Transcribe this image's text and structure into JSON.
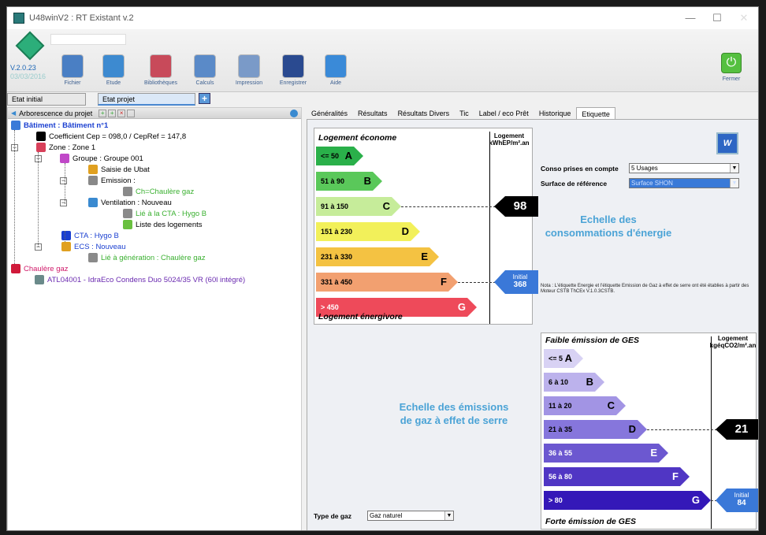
{
  "window": {
    "title": "U48winV2 : RT Existant v.2",
    "controls": [
      "—",
      "☐",
      "✕"
    ]
  },
  "toolbar": {
    "version": "V.2.0.23",
    "version_date": "03/03/2016",
    "buttons": [
      {
        "label": "Fichier",
        "icon": "fichier-icon",
        "color": "#4a7fc4"
      },
      {
        "label": "Etude",
        "icon": "etude-icon",
        "color": "#3d8ad0"
      },
      {
        "label": "Bibliothèques",
        "icon": "books-icon",
        "color": "#c84a5a"
      },
      {
        "label": "Calculs",
        "icon": "calculator-icon",
        "color": "#5a8ac8"
      },
      {
        "label": "Impression",
        "icon": "printer-icon",
        "color": "#7a9ac8"
      },
      {
        "label": "Enregistrer",
        "icon": "save-icon",
        "color": "#2a4a90"
      },
      {
        "label": "Aide",
        "icon": "help-icon",
        "color": "#3a8ad8"
      }
    ],
    "close_label": "Fermer"
  },
  "state_tabs": [
    "Etat initial",
    "Etat projet"
  ],
  "tree": {
    "header": "Arborescence du projet",
    "items": [
      {
        "text": "Bâtiment : Bâtiment n°1",
        "color": "#1a3fd0",
        "bold": true
      },
      {
        "text": "Coefficient Cep =  098,0 / CepRef =  147,8",
        "color": "#000"
      },
      {
        "text": "Zone : Zone 1",
        "color": "#000"
      },
      {
        "text": "Groupe : Groupe 001",
        "color": "#000"
      },
      {
        "text": "Saisie de Ubat",
        "color": "#000"
      },
      {
        "text": "Emission :",
        "color": "#000"
      },
      {
        "text": "Ch=Chaulère gaz",
        "color": "#3ab030"
      },
      {
        "text": "Ventilation : Nouveau",
        "color": "#000"
      },
      {
        "text": "Lié à la CTA : Hygo B",
        "color": "#3ab030"
      },
      {
        "text": "Liste des logements",
        "color": "#000"
      },
      {
        "text": "CTA : Hygo B",
        "color": "#1a3fd0"
      },
      {
        "text": "ECS : Nouveau",
        "color": "#1a3fd0"
      },
      {
        "text": "Lié à génération : Chaulère gaz",
        "color": "#3ab030"
      },
      {
        "text": "Chaulère gaz",
        "color": "#d01a6a"
      },
      {
        "text": "ATL04001 - IdraEco Condens Duo 5024/35 VR (60l intégré)",
        "color": "#6a2ab0"
      }
    ]
  },
  "right_tabs": [
    "Généralités",
    "Résultats",
    "Résultats Divers",
    "Tic",
    "Label / eco Prêt",
    "Historique",
    "Etiquette"
  ],
  "energy": {
    "top": "Logement économe",
    "bottom": "Logement énergivore",
    "unit_title": "Logement",
    "unit": "kWhEP/m².an",
    "classes": [
      {
        "range": "<= 50",
        "letter": "A",
        "color": "#2ab04a"
      },
      {
        "range": "51 à 90",
        "letter": "B",
        "color": "#5ac85a"
      },
      {
        "range": "91 à 150",
        "letter": "C",
        "color": "#c6ec9a"
      },
      {
        "range": "151 à 230",
        "letter": "D",
        "color": "#f2f05a"
      },
      {
        "range": "231 à 330",
        "letter": "E",
        "color": "#f4c242"
      },
      {
        "range": "331 à 450",
        "letter": "F",
        "color": "#f2a070"
      },
      {
        "range": "> 450",
        "letter": "G",
        "color": "#ee4a5a"
      }
    ],
    "value": "98",
    "value_class_index": 2,
    "initial_label": "Initial",
    "initial_value": "368",
    "initial_class_index": 5,
    "caption": "Echelle des consommations d'énergie"
  },
  "ghg": {
    "top": "Faible émission de GES",
    "bottom": "Forte émission de GES",
    "unit_title": "Logement",
    "unit": "kgéqCO2/m².an",
    "classes": [
      {
        "range": "<= 5",
        "letter": "A",
        "color": "#d8d2f4"
      },
      {
        "range": "6 à 10",
        "letter": "B",
        "color": "#bcb2ec"
      },
      {
        "range": "11 à 20",
        "letter": "C",
        "color": "#a294e4"
      },
      {
        "range": "21 à 35",
        "letter": "D",
        "color": "#8676dc"
      },
      {
        "range": "36 à 55",
        "letter": "E",
        "color": "#6c58d0"
      },
      {
        "range": "56 à 80",
        "letter": "F",
        "color": "#5036c4"
      },
      {
        "range": "> 80",
        "letter": "G",
        "color": "#3418b8"
      }
    ],
    "value": "21",
    "value_class_index": 3,
    "initial_label": "Initial",
    "initial_value": "84",
    "initial_class_index": 6,
    "caption": "Echelle des émissions de gaz à effet de serre"
  },
  "options": {
    "conso_label": "Conso prises en compte",
    "conso_value": "5 Usages",
    "surface_label": "Surface de référence",
    "surface_value": "Surface SHON",
    "note": "Nota : L'étiquette Energie et l'étiquette Emission de Gaz à effet de serre ont été établies à partir des Moteur CSTB ThCEx V.1.0.3CSTB.",
    "gas_label": "Type de gaz",
    "gas_value": "Gaz naturel"
  }
}
